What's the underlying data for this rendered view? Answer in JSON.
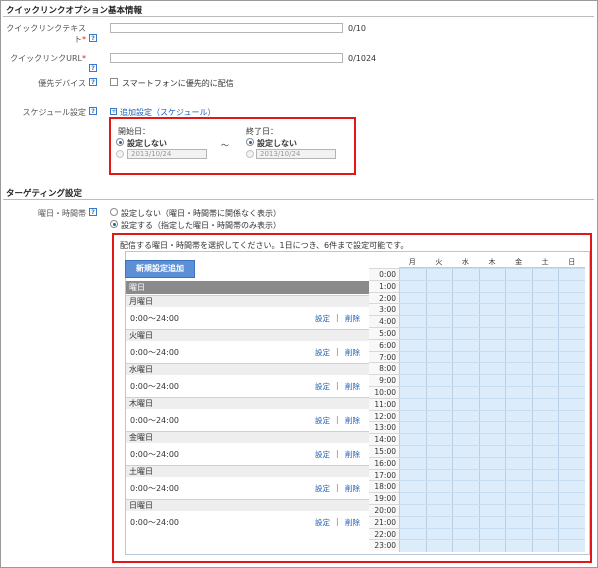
{
  "section1": {
    "title": "クイックリンクオプション基本情報",
    "link_text": {
      "label": "クイックリンクテキスト",
      "required": "*",
      "count": "0/10"
    },
    "link_url": {
      "label": "クイックリンクURL",
      "required": "*",
      "count": "0/1024"
    },
    "priority": {
      "label": "優先デバイス",
      "checkbox_label": "スマートフォンに優先的に配信"
    },
    "schedule": {
      "label": "スケジュール設定",
      "add_link": "追加設定（スケジュール）",
      "start": {
        "title": "開始日：",
        "option_none": "設定しない",
        "date": "2013/10/24"
      },
      "tilde": "～",
      "end": {
        "title": "終了日：",
        "option_none": "設定しない",
        "date": "2013/10/24"
      }
    }
  },
  "section2": {
    "title": "ターゲティング設定",
    "daytime": {
      "label": "曜日・時間帯",
      "option_off": "設定しない（曜日・時間帯に関係なく表示）",
      "option_on": "設定する（指定した曜日・時間帯のみ表示）"
    },
    "panel": {
      "instruction": "配信する曜日・時間帯を選択してください。1日につき、6件まで設定可能です。",
      "add_button": "新規設定追加",
      "day_header": "曜日",
      "days": [
        {
          "name": "月曜日",
          "time": "0:00～24:00",
          "edit": "設定",
          "sep": "|",
          "delete": "削除"
        },
        {
          "name": "火曜日",
          "time": "0:00～24:00",
          "edit": "設定",
          "sep": "|",
          "delete": "削除"
        },
        {
          "name": "水曜日",
          "time": "0:00～24:00",
          "edit": "設定",
          "sep": "|",
          "delete": "削除"
        },
        {
          "name": "木曜日",
          "time": "0:00～24:00",
          "edit": "設定",
          "sep": "|",
          "delete": "削除"
        },
        {
          "name": "金曜日",
          "time": "0:00～24:00",
          "edit": "設定",
          "sep": "|",
          "delete": "削除"
        },
        {
          "name": "土曜日",
          "time": "0:00～24:00",
          "edit": "設定",
          "sep": "|",
          "delete": "削除"
        },
        {
          "name": "日曜日",
          "time": "0:00～24:00",
          "edit": "設定",
          "sep": "|",
          "delete": "削除"
        }
      ],
      "hours": [
        "0:00",
        "1:00",
        "2:00",
        "3:00",
        "4:00",
        "5:00",
        "6:00",
        "7:00",
        "8:00",
        "9:00",
        "10:00",
        "11:00",
        "12:00",
        "13:00",
        "14:00",
        "15:00",
        "16:00",
        "17:00",
        "18:00",
        "19:00",
        "20:00",
        "21:00",
        "22:00",
        "23:00"
      ],
      "weekday_headers": [
        "月",
        "火",
        "水",
        "木",
        "金",
        "土",
        "日"
      ]
    }
  },
  "colors": {
    "highlight": "#e01818",
    "link": "#1d5fb8",
    "button": "#5b8fd6",
    "grid_fill": "#dcecfa"
  },
  "icons": {
    "help": "question-mark-icon",
    "add": "plus-box-icon"
  }
}
